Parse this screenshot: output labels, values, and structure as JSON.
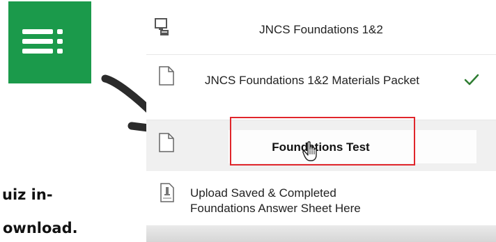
{
  "caption": {
    "line1": "uiz in-",
    "line2": "ownload."
  },
  "menu_tile": {
    "icon": "list-menu-icon",
    "color": "#1b9a4b"
  },
  "course_items": [
    {
      "label": "JNCS Foundations 1&2",
      "icon": "computer-link-icon"
    },
    {
      "label": "JNCS Foundations 1&2 Materials Packet",
      "icon": "document-icon",
      "completed": true
    },
    {
      "label": "Foundations Test",
      "icon": "document-icon",
      "highlighted": true
    },
    {
      "label": "Upload Saved & Completed Foundations Answer Sheet Here",
      "icon": "assignment-file-icon"
    }
  ],
  "highlight_color": "#e0262b",
  "check_color": "#2e7d32"
}
